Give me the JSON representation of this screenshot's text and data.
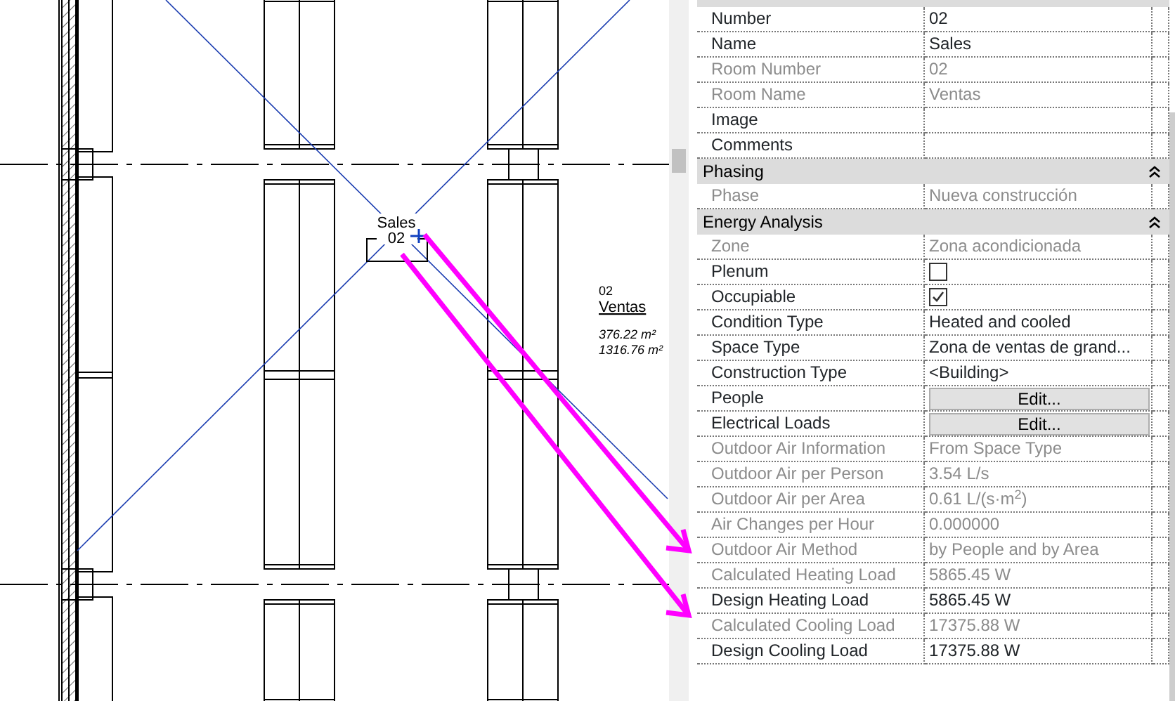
{
  "drawing": {
    "room_tag": {
      "name": "Sales",
      "number": "02"
    },
    "room_label": {
      "number": "02",
      "name": "Ventas",
      "area": "376.22 m²",
      "volume": "1316.76 m²"
    }
  },
  "properties": {
    "sections": [
      {
        "rows": [
          {
            "kind": "text",
            "label": "Number",
            "value": "02",
            "disabled": false
          },
          {
            "kind": "text",
            "label": "Name",
            "value": "Sales",
            "disabled": false
          },
          {
            "kind": "text",
            "label": "Room Number",
            "value": "02",
            "disabled": true
          },
          {
            "kind": "text",
            "label": "Room Name",
            "value": "Ventas",
            "disabled": true
          },
          {
            "kind": "text",
            "label": "Image",
            "disabled": false
          },
          {
            "kind": "text",
            "label": "Comments",
            "disabled": false
          }
        ]
      },
      {
        "title": "Phasing",
        "expanded": true,
        "rows": [
          {
            "kind": "text",
            "label": "Phase",
            "value": "Nueva construcción",
            "disabled": true
          }
        ]
      },
      {
        "title": "Energy Analysis",
        "expanded": true,
        "rows": [
          {
            "kind": "text",
            "label": "Zone",
            "value": "Zona acondicionada",
            "disabled": true
          },
          {
            "kind": "checkbox",
            "label": "Plenum",
            "checked": false,
            "disabled": false
          },
          {
            "kind": "checkbox",
            "label": "Occupiable",
            "checked": true,
            "disabled": false
          },
          {
            "kind": "text",
            "label": "Condition Type",
            "value": "Heated and cooled",
            "disabled": false
          },
          {
            "kind": "text",
            "label": "Space Type",
            "value": "Zona de ventas de grand...",
            "disabled": false
          },
          {
            "kind": "text",
            "label": "Construction Type",
            "value": "<Building>",
            "disabled": false
          },
          {
            "kind": "button",
            "label": "People",
            "value": "Edit...",
            "disabled": false
          },
          {
            "kind": "button",
            "label": "Electrical Loads",
            "value": "Edit...",
            "disabled": false
          },
          {
            "kind": "text",
            "label": "Outdoor Air Information",
            "value": "From Space Type",
            "disabled": true
          },
          {
            "kind": "text",
            "label": "Outdoor Air per Person",
            "value": "3.54 L/s",
            "disabled": true
          },
          {
            "kind": "text",
            "label": "Outdoor Air per Area",
            "value": "0.61 L/(s·m$^{2}$)",
            "disabled": true
          },
          {
            "kind": "text",
            "label": "Air Changes per Hour",
            "value": "0.000000",
            "disabled": true
          },
          {
            "kind": "text",
            "label": "Outdoor Air Method",
            "value": "by People and by Area",
            "disabled": true
          },
          {
            "kind": "text",
            "label": "Calculated Heating Load",
            "value": "5865.45 W",
            "disabled": true
          },
          {
            "kind": "text",
            "label": "Design Heating Load",
            "value": "5865.45 W",
            "disabled": false
          },
          {
            "kind": "text",
            "label": "Calculated Cooling Load",
            "value": "17375.88 W",
            "disabled": true
          },
          {
            "kind": "text",
            "label": "Design Cooling Load",
            "value": "17375.88 W",
            "disabled": false
          }
        ]
      }
    ]
  }
}
